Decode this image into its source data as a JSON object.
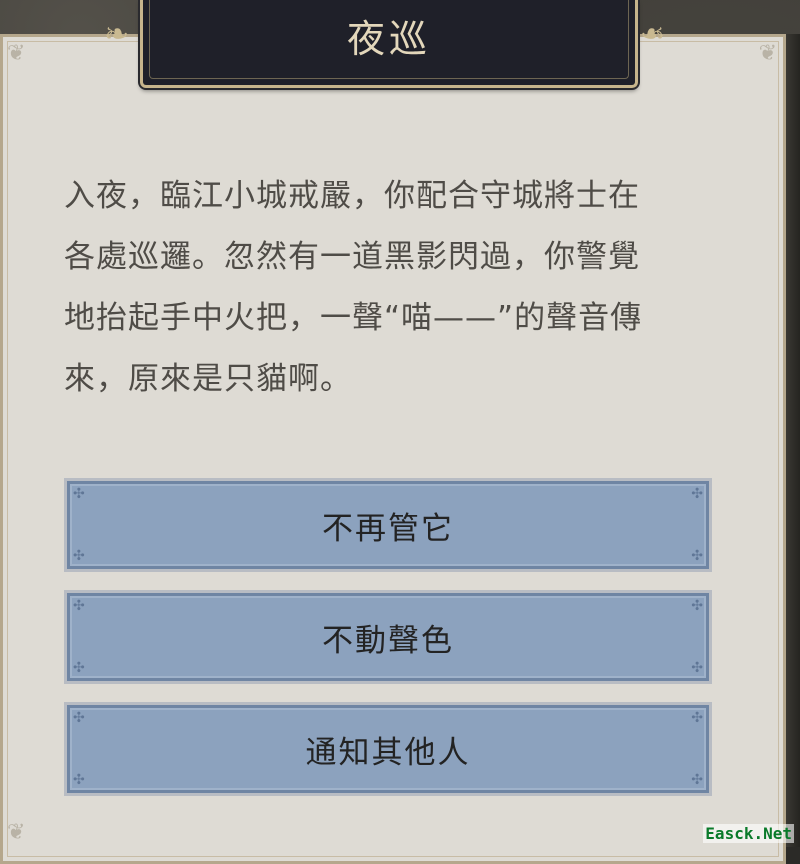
{
  "event": {
    "title": "夜巡",
    "story_lines": [
      "入夜，臨江小城戒嚴，你配合守城將士在",
      "各處巡邏。忽然有一道黑影閃過，你警覺",
      "地抬起手中火把，一聲“喵——”的聲音傳",
      "來，原來是只貓啊。"
    ]
  },
  "options": [
    {
      "label": "不再管它"
    },
    {
      "label": "不動聲色"
    },
    {
      "label": "通知其他人"
    }
  ],
  "ornaments": {
    "panel_corner_icon": "flourish-icon",
    "plaque_wing_icon": "scroll-wing-icon"
  },
  "watermark": "Easck.Net",
  "colors": {
    "panel": "#dedbd4",
    "plaque": "#1f2029",
    "plaque_border": "#c7b58c",
    "button_fill": "#8ca2be",
    "title_text": "#e3d7bb",
    "body_text": "#4f4c47"
  }
}
